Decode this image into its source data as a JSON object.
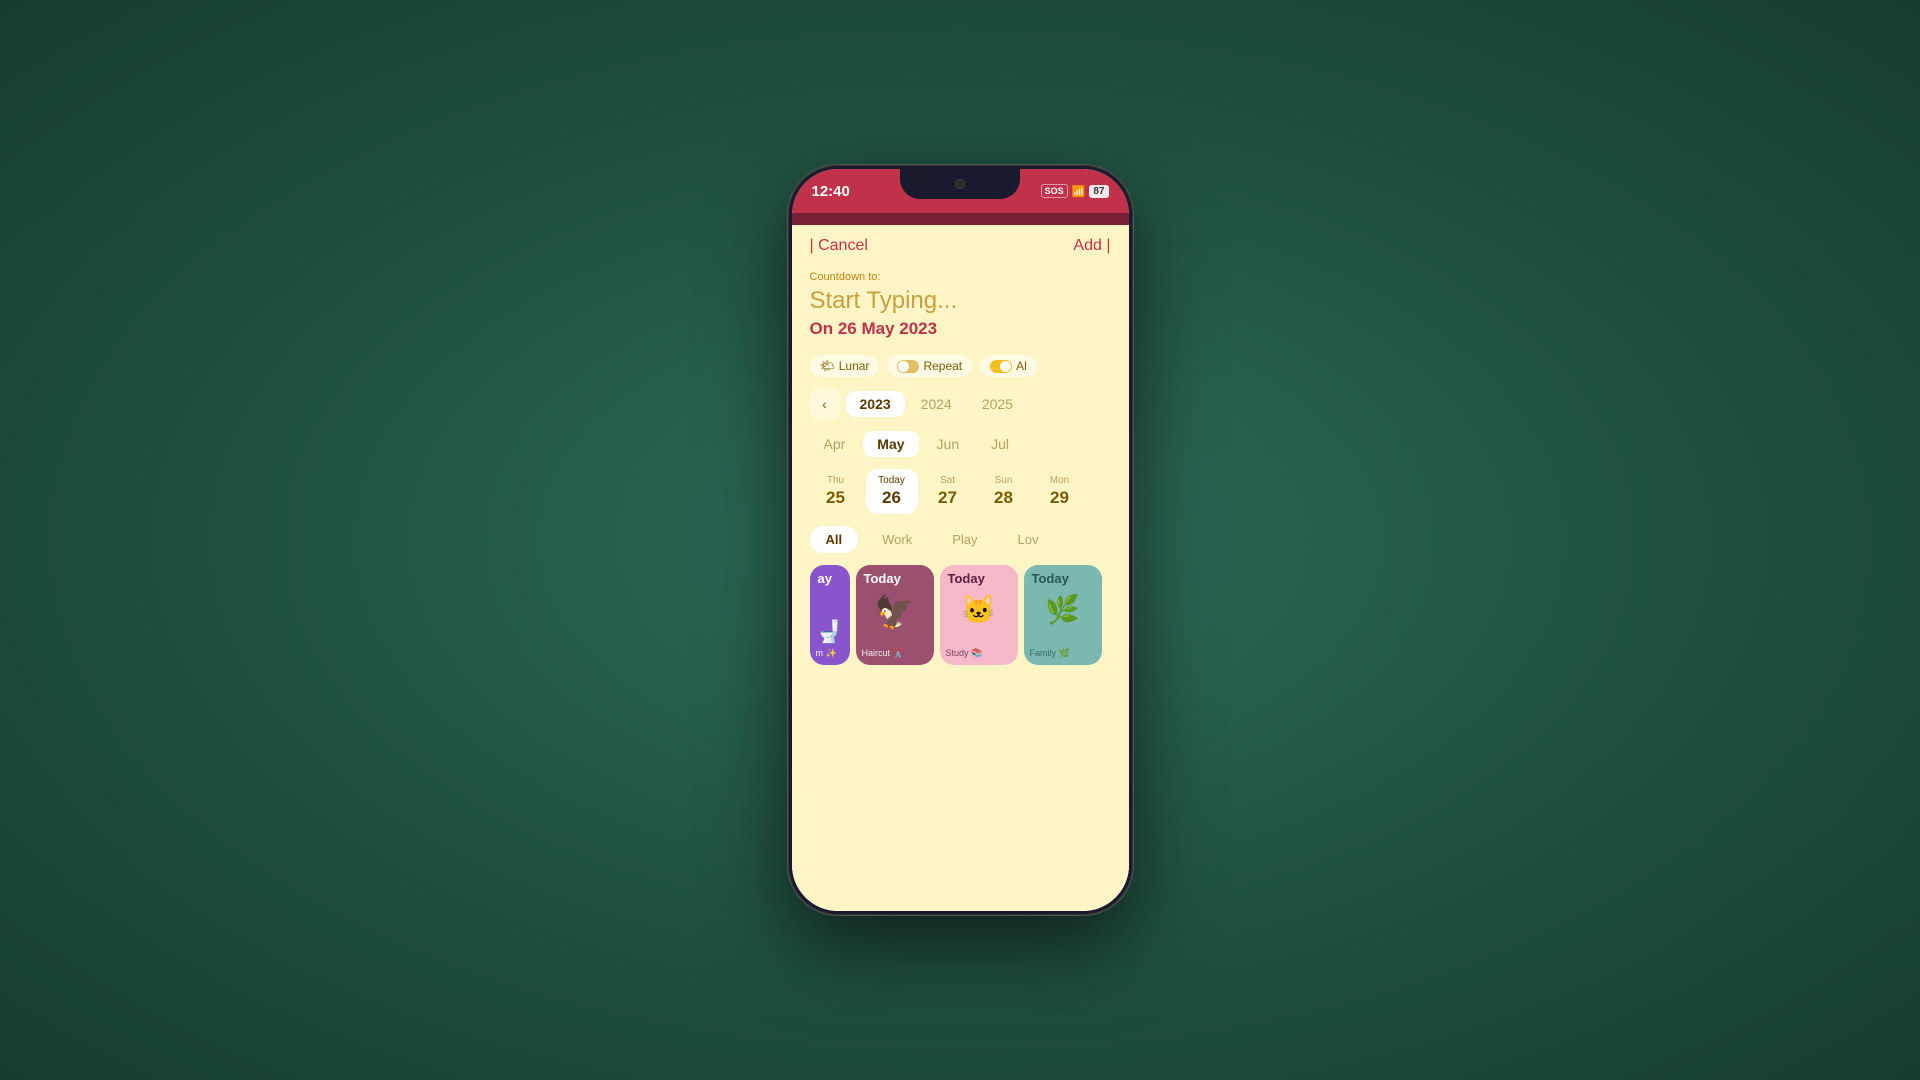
{
  "phone": {
    "status_bar": {
      "time": "12:40",
      "sos": "SOS",
      "battery": "87"
    },
    "header": {
      "cancel_label": "| Cancel",
      "add_label": "Add |"
    },
    "countdown": {
      "label": "Countdown to:",
      "placeholder": "Start Typing...",
      "date": "On 26 May 2023"
    },
    "toggles": [
      {
        "id": "lunar",
        "icon": "🌤",
        "label": "Lunar",
        "state": "off"
      },
      {
        "id": "repeat",
        "icon": "",
        "label": "Repeat",
        "state": "off"
      },
      {
        "id": "alarm",
        "icon": "",
        "label": "Al",
        "state": "on"
      }
    ],
    "years": {
      "selected": "2023",
      "items": [
        "2023",
        "2024",
        "2025"
      ]
    },
    "months": {
      "selected": "May",
      "items": [
        "Apr",
        "May",
        "Jun",
        "Jul"
      ]
    },
    "days": {
      "selected": "26",
      "items": [
        {
          "name": "Thu",
          "num": "25"
        },
        {
          "name": "Today",
          "num": "26",
          "selected": true
        },
        {
          "name": "Sat",
          "num": "27"
        },
        {
          "name": "Sun",
          "num": "28"
        },
        {
          "name": "Mon",
          "num": "29"
        }
      ]
    },
    "categories": {
      "selected": "All",
      "items": [
        "All",
        "Work",
        "Play",
        "Lov"
      ]
    },
    "cards": [
      {
        "id": "partial-left",
        "label": "ay",
        "theme": "purple",
        "partial": true
      },
      {
        "id": "haircut",
        "label": "Today",
        "category": "Haircut ✂️",
        "theme": "dark-pink",
        "character": "🦅"
      },
      {
        "id": "study",
        "label": "Today",
        "category": "Study 📚",
        "theme": "light-pink",
        "character": "🐱"
      },
      {
        "id": "family",
        "label": "Today",
        "category": "Family 🌿",
        "theme": "teal",
        "character": "🌿"
      }
    ]
  }
}
